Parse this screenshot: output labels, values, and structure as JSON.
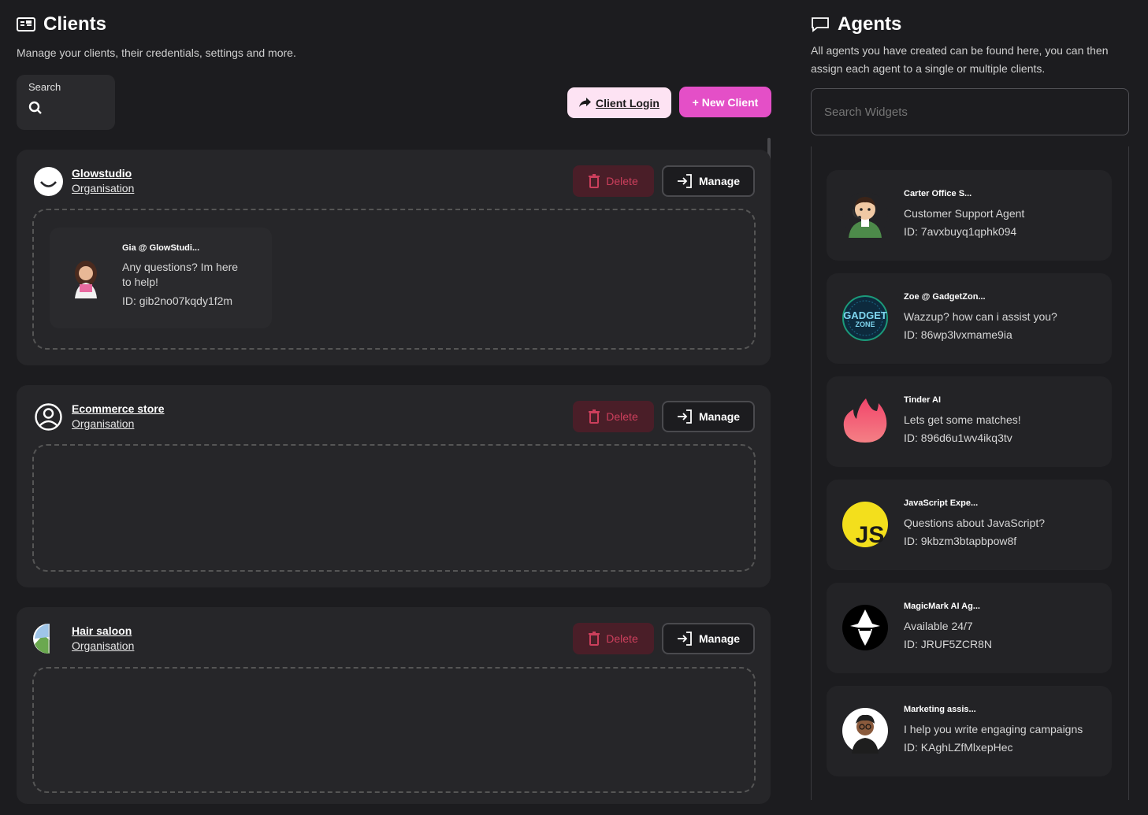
{
  "clients": {
    "title": "Clients",
    "subtitle": "Manage your clients, their credentials, settings and more.",
    "search_label": "Search",
    "client_login_label": "Client Login",
    "new_client_label": "+ New Client",
    "delete_label": "Delete",
    "manage_label": "Manage",
    "items": [
      {
        "name": "Glowstudio",
        "type": "Organisation",
        "agents": [
          {
            "name": "Gia @ GlowStudi...",
            "line1": "Any questions? Im here",
            "line2": "to help!",
            "id": "ID: gib2no07kqdy1f2m"
          }
        ]
      },
      {
        "name": "Ecommerce store",
        "type": "Organisation",
        "agents": []
      },
      {
        "name": "Hair saloon",
        "type": "Organisation",
        "agents": []
      }
    ]
  },
  "agents": {
    "title": "Agents",
    "subtitle_line1": "All agents you have created can be found here, you can then",
    "subtitle_line2": "assign each agent to a single or multiple clients.",
    "search_placeholder": "Search Widgets",
    "items": [
      {
        "name": "Carter Office S...",
        "desc": "Customer Support Agent",
        "id": "ID: 7avxbuyq1qphk094",
        "avatar_color": "#e8d6c0"
      },
      {
        "name": "Zoe @ GadgetZon...",
        "desc": "Wazzup? how can i assist you?",
        "id": "ID: 86wp3lvxmame9ia",
        "avatar_color": "#0d2a3d",
        "avatar_text_1": "GADGET",
        "avatar_text_2": "ZONE"
      },
      {
        "name": "Tinder AI",
        "desc": "Lets get some matches!",
        "id": "ID: 896d6u1wv4ikq3tv",
        "avatar_color": "#f0565c"
      },
      {
        "name": "JavaScript Expe...",
        "desc": "Questions about JavaScript?",
        "id": "ID: 9kbzm3btapbpow8f",
        "avatar_color": "#f3df1c",
        "avatar_text": "JS"
      },
      {
        "name": "MagicMark AI Ag...",
        "desc": "Available 24/7",
        "id": "ID: JRUF5ZCR8N",
        "avatar_color": "#000000"
      },
      {
        "name": "Marketing assis...",
        "desc": "I help you write engaging campaigns",
        "id": "ID: KAghLZfMlxepHec",
        "avatar_color": "#ffffff"
      }
    ]
  }
}
